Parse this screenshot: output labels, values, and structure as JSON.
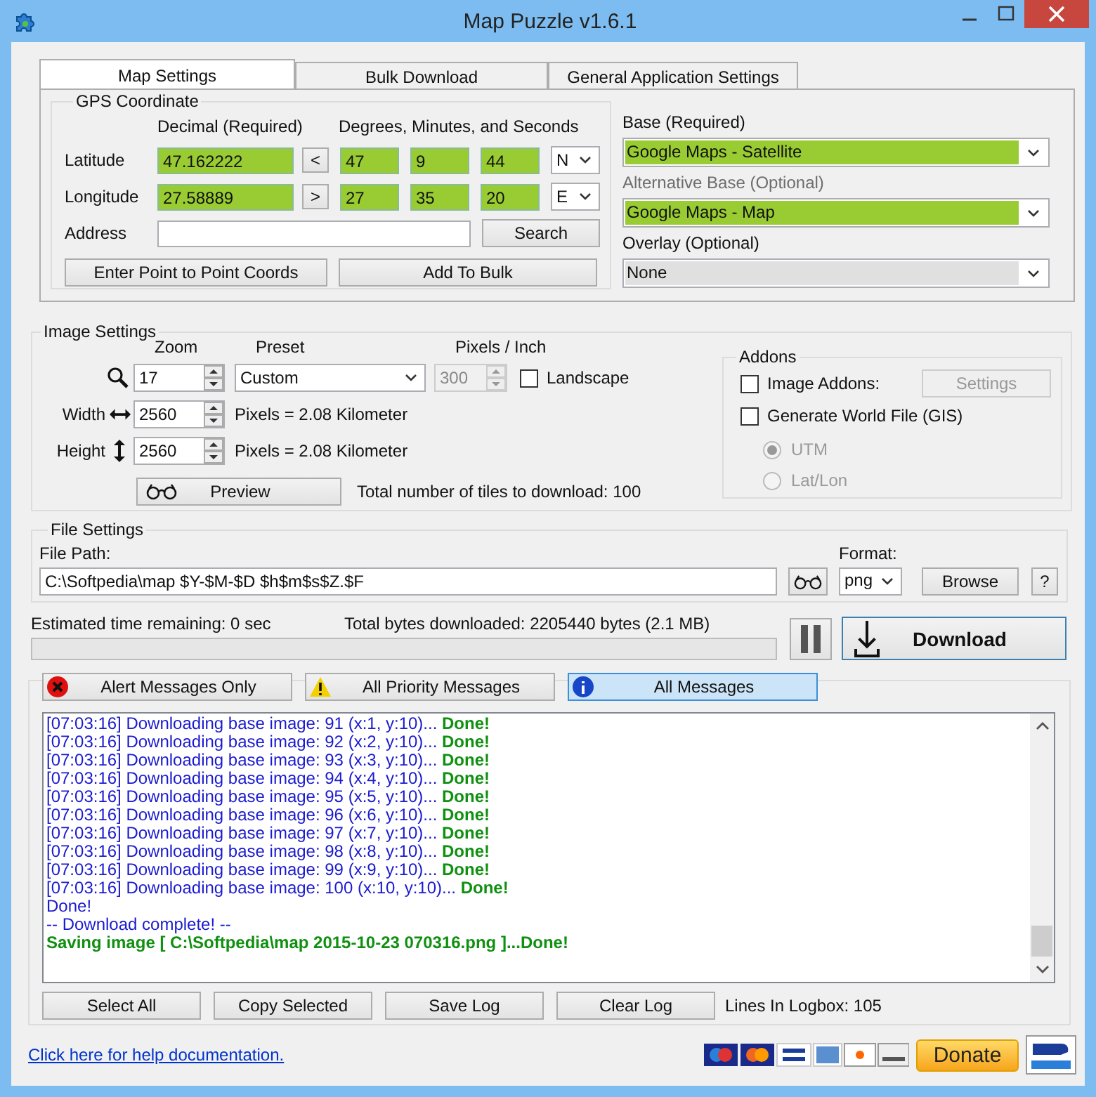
{
  "window": {
    "title": "Map Puzzle v1.6.1"
  },
  "tabs": [
    {
      "label": "Map Settings",
      "selected": true
    },
    {
      "label": "Bulk Download",
      "selected": false
    },
    {
      "label": "General Application Settings",
      "selected": false
    }
  ],
  "gps": {
    "title": "GPS Coordinate",
    "decimal_header": "Decimal (Required)",
    "dms_header": "Degrees, Minutes, and Seconds",
    "rows": [
      {
        "label": "Latitude",
        "decimal": "47.162222",
        "arrow": "<",
        "degrees": "47",
        "minutes": "9",
        "seconds": "44",
        "hemisphere": "N"
      },
      {
        "label": "Longitude",
        "decimal": "27.58889",
        "arrow": ">",
        "degrees": "27",
        "minutes": "35",
        "seconds": "20",
        "hemisphere": "E"
      }
    ],
    "address_label": "Address",
    "search_button": "Search",
    "buttons": [
      "Enter Point to Point Coords",
      "Add To Bulk"
    ]
  },
  "layers": [
    {
      "label": "Base (Required)",
      "value": "Google Maps - Satellite",
      "dimmed": false,
      "filled": true
    },
    {
      "label": "Alternative Base (Optional)",
      "value": "Google Maps - Map",
      "dimmed": true,
      "filled": true
    },
    {
      "label": "Overlay (Optional)",
      "value": "None",
      "dimmed": false,
      "filled": false
    }
  ],
  "image_settings": {
    "title": "Image Settings",
    "zoom": {
      "label": "Zoom",
      "value": "17"
    },
    "preset": {
      "label": "Preset",
      "value": "Custom"
    },
    "ppi": {
      "label": "Pixels / Inch",
      "value": "300",
      "disabled": true
    },
    "landscape": {
      "label": "Landscape",
      "checked": false
    },
    "sizes": [
      {
        "label": "Width",
        "value": "2560",
        "note": "Pixels = 2.08 Kilometer",
        "kind": "width"
      },
      {
        "label": "Height",
        "value": "2560",
        "note": "Pixels = 2.08 Kilometer",
        "kind": "height"
      }
    ],
    "preview_button": "Preview",
    "tiles_text": "Total number of tiles to download: 100"
  },
  "addons": {
    "title": "Addons",
    "checks": [
      {
        "label": "Image Addons:",
        "checked": false
      },
      {
        "label": "Generate World File (GIS)",
        "checked": false
      }
    ],
    "settings_button": {
      "label": "Settings",
      "disabled": true
    },
    "radios": [
      {
        "label": "UTM",
        "selected": true,
        "disabled": true
      },
      {
        "label": "Lat/Lon",
        "selected": false,
        "disabled": true
      }
    ]
  },
  "file_settings": {
    "title": "File Settings",
    "path_label": "File Path:",
    "path": "C:\\Softpedia\\map $Y-$M-$D $h$m$s$Z.$F",
    "format_label": "Format:",
    "format": "png",
    "browse_button": "Browse",
    "help_button": "?"
  },
  "progress": {
    "eta": "Estimated time remaining: 0 sec",
    "bytes": "Total bytes downloaded: 2205440 bytes (2.1 MB)",
    "level": 0
  },
  "download_button": "Download",
  "filters": [
    {
      "label": "Alert Messages Only",
      "kind": "alert",
      "selected": false
    },
    {
      "label": "All Priority Messages",
      "kind": "priority",
      "selected": false
    },
    {
      "label": "All Messages",
      "kind": "info",
      "selected": true
    }
  ],
  "log": [
    {
      "kind": "progress",
      "text": "[07:03:16] Downloading base image: 91 (x:1, y:10)... **Done!**"
    },
    {
      "kind": "progress",
      "text": "[07:03:16] Downloading base image: 92 (x:2, y:10)... **Done!**"
    },
    {
      "kind": "progress",
      "text": "[07:03:16] Downloading base image: 93 (x:3, y:10)... **Done!**"
    },
    {
      "kind": "progress",
      "text": "[07:03:16] Downloading base image: 94 (x:4, y:10)... **Done!**"
    },
    {
      "kind": "progress",
      "text": "[07:03:16] Downloading base image: 95 (x:5, y:10)... **Done!**"
    },
    {
      "kind": "progress",
      "text": "[07:03:16] Downloading base image: 96 (x:6, y:10)... **Done!**"
    },
    {
      "kind": "progress",
      "text": "[07:03:16] Downloading base image: 97 (x:7, y:10)... **Done!**"
    },
    {
      "kind": "progress",
      "text": "[07:03:16] Downloading base image: 98 (x:8, y:10)... **Done!**"
    },
    {
      "kind": "progress",
      "text": "[07:03:16] Downloading base image: 99 (x:9, y:10)... **Done!**"
    },
    {
      "kind": "progress",
      "text": "[07:03:16] Downloading base image: 100 (x:10, y:10)... **Done!**"
    },
    {
      "kind": "info",
      "text": "Done!"
    },
    {
      "kind": "info",
      "text": "-- Download complete! --"
    },
    {
      "kind": "success",
      "text": "Saving image [ C:\\Softpedia\\map 2015-10-23 070316.png ]...Done!"
    }
  ],
  "log_buttons": [
    "Select All",
    "Copy Selected",
    "Save Log",
    "Clear Log"
  ],
  "log_count": "Lines In Logbox: 105",
  "footer": {
    "help_link": "Click here for help documentation.",
    "donate_button": "Donate"
  }
}
